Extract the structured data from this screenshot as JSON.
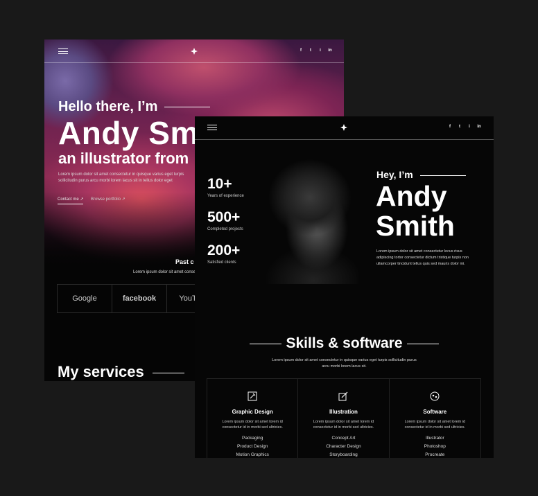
{
  "back": {
    "socials": [
      "f",
      "t",
      "i",
      "in"
    ],
    "hello": "Hello there, I’m",
    "name": "Andy Smith",
    "subtitle": "an illustrator from",
    "intro": [
      "Lorem ipsum dolor sit amet consectetur in quisque varius eget turpis",
      "sollicitudin purus arcu morbi lorem lacus sit in tellus dolor eget"
    ],
    "contact": "Contact me ↗",
    "portfolio": "Browse portfolio ↗",
    "past_clients": "Past c",
    "past_text": "Lorem ipsum dolor sit amet conse",
    "clients": [
      "Google",
      "facebook",
      "YouTube"
    ],
    "services": "My services"
  },
  "front": {
    "socials": [
      "f",
      "t",
      "i",
      "in"
    ],
    "stats": [
      {
        "num": "10+",
        "label": "Years of experience"
      },
      {
        "num": "500+",
        "label": "Completed projects"
      },
      {
        "num": "200+",
        "label": "Satisfied clients"
      }
    ],
    "hey": "Hey, I’m",
    "first": "Andy",
    "last": "Smith",
    "bio": [
      "Lorem ipsum dolor sit amet consectetur locus risus",
      "adipiscing tortor consectetur dictum tristique turpis non",
      "ullamcorper tincidunt tellus quis sed mauris dolor mi."
    ],
    "skills_title": "Skills & software",
    "skills_text": [
      "Lorem ipsum dolor sit amet consectetur in quisque varius eget turpis sollicitudin purus",
      "arcu morbi lorem lacus sit."
    ],
    "columns": [
      {
        "title": "Graphic Design",
        "icon": "graphic-design-icon",
        "desc": "Lorem ipsum dolor sit amet lorem id consectetur id in morbi sed ultricies.",
        "items": [
          "Packaging",
          "Product Design",
          "Motion Graphics"
        ]
      },
      {
        "title": "Illustration",
        "icon": "illustration-icon",
        "desc": "Lorem ipsum dolor sit amet lorem id consectetur id in morbi sed ultricies.",
        "items": [
          "Concept Art",
          "Character Design",
          "Storyboarding"
        ]
      },
      {
        "title": "Software",
        "icon": "software-icon",
        "desc": "Lorem ipsum dolor sit amet lorem id consectetur id in morbi sed ultricies.",
        "items": [
          "Illustrator",
          "Photoshop",
          "Procreate"
        ]
      }
    ]
  }
}
